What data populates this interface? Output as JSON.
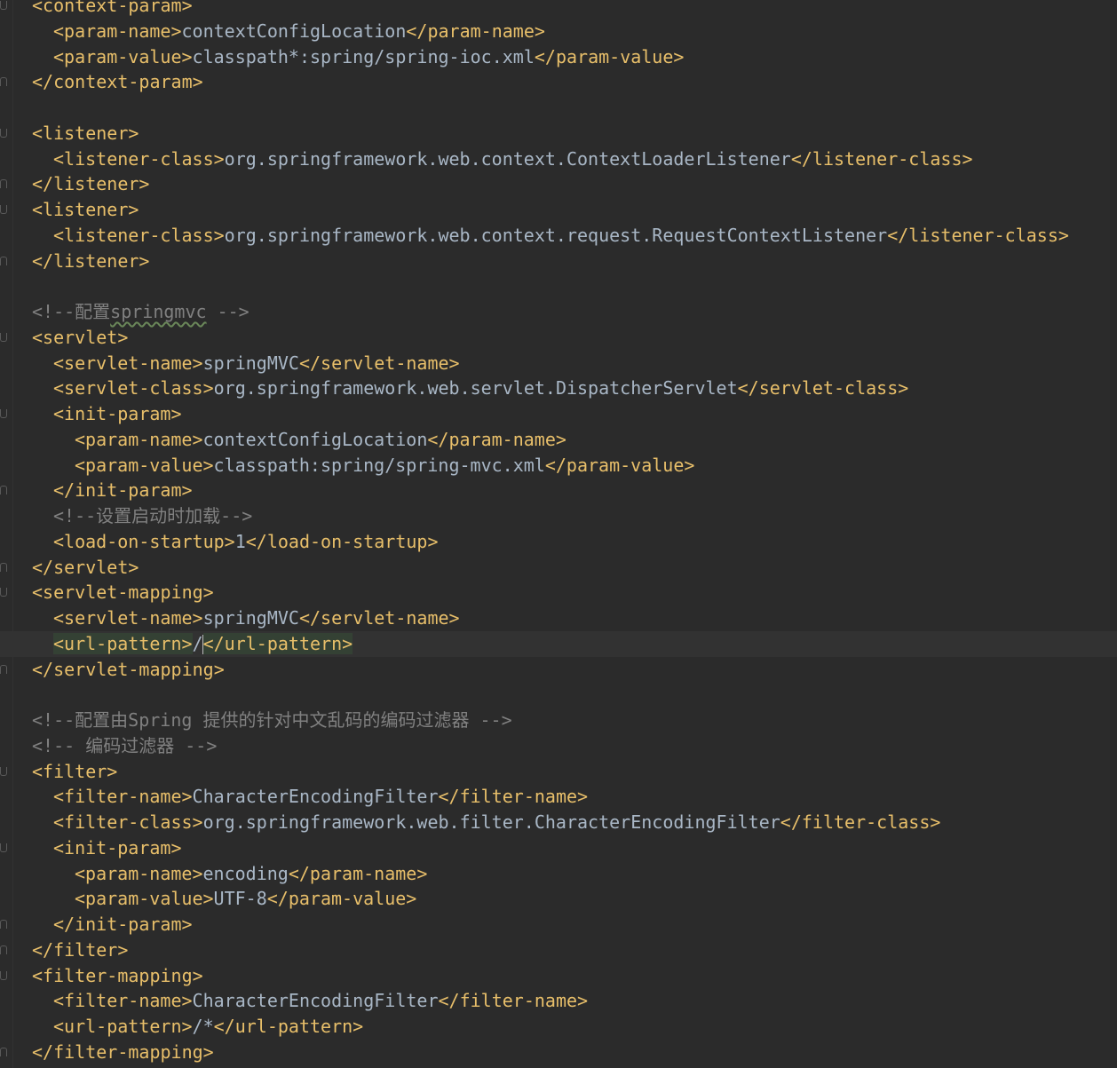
{
  "editor": {
    "lines": [
      {
        "indent": 0,
        "fold": "open",
        "parts": [
          {
            "t": "tag",
            "v": "<context-param>"
          }
        ]
      },
      {
        "indent": 1,
        "parts": [
          {
            "t": "tag",
            "v": "<param-name>"
          },
          {
            "t": "txt",
            "v": "contextConfigLocation"
          },
          {
            "t": "tag",
            "v": "</param-name>"
          }
        ]
      },
      {
        "indent": 1,
        "parts": [
          {
            "t": "tag",
            "v": "<param-value>"
          },
          {
            "t": "txt",
            "v": "classpath*:spring/spring-ioc.xml"
          },
          {
            "t": "tag",
            "v": "</param-value>"
          }
        ]
      },
      {
        "indent": 0,
        "fold": "close",
        "parts": [
          {
            "t": "tag",
            "v": "</context-param>"
          }
        ]
      },
      {
        "indent": 0,
        "parts": []
      },
      {
        "indent": 0,
        "fold": "open",
        "parts": [
          {
            "t": "tag",
            "v": "<listener>"
          }
        ]
      },
      {
        "indent": 1,
        "parts": [
          {
            "t": "tag",
            "v": "<listener-class>"
          },
          {
            "t": "txt",
            "v": "org.springframework.web.context.ContextLoaderListener"
          },
          {
            "t": "tag",
            "v": "</listener-class>"
          }
        ]
      },
      {
        "indent": 0,
        "fold": "close",
        "parts": [
          {
            "t": "tag",
            "v": "</listener>"
          }
        ]
      },
      {
        "indent": 0,
        "fold": "open",
        "parts": [
          {
            "t": "tag",
            "v": "<listener>"
          }
        ]
      },
      {
        "indent": 1,
        "parts": [
          {
            "t": "tag",
            "v": "<listener-class>"
          },
          {
            "t": "txt",
            "v": "org.springframework.web.context.request.RequestContextListener"
          },
          {
            "t": "tag",
            "v": "</listener-class>"
          }
        ]
      },
      {
        "indent": 0,
        "fold": "close",
        "parts": [
          {
            "t": "tag",
            "v": "</listener>"
          }
        ]
      },
      {
        "indent": 0,
        "parts": []
      },
      {
        "indent": 0,
        "parts": [
          {
            "t": "cmt",
            "v": "<!--配置"
          },
          {
            "t": "cmt squiggle",
            "v": "springmvc"
          },
          {
            "t": "cmt",
            "v": " -->"
          }
        ]
      },
      {
        "indent": 0,
        "fold": "open",
        "parts": [
          {
            "t": "tag",
            "v": "<servlet>"
          }
        ]
      },
      {
        "indent": 1,
        "parts": [
          {
            "t": "tag",
            "v": "<servlet-name>"
          },
          {
            "t": "txt",
            "v": "springMVC"
          },
          {
            "t": "tag",
            "v": "</servlet-name>"
          }
        ]
      },
      {
        "indent": 1,
        "parts": [
          {
            "t": "tag",
            "v": "<servlet-class>"
          },
          {
            "t": "txt",
            "v": "org.springframework.web.servlet.DispatcherServlet"
          },
          {
            "t": "tag",
            "v": "</servlet-class>"
          }
        ]
      },
      {
        "indent": 1,
        "fold": "open",
        "parts": [
          {
            "t": "tag",
            "v": "<init-param>"
          }
        ]
      },
      {
        "indent": 2,
        "parts": [
          {
            "t": "tag",
            "v": "<param-name>"
          },
          {
            "t": "txt",
            "v": "contextConfigLocation"
          },
          {
            "t": "tag",
            "v": "</param-name>"
          }
        ]
      },
      {
        "indent": 2,
        "parts": [
          {
            "t": "tag",
            "v": "<param-value>"
          },
          {
            "t": "txt",
            "v": "classpath:spring/spring-mvc.xml"
          },
          {
            "t": "tag",
            "v": "</param-value>"
          }
        ]
      },
      {
        "indent": 1,
        "fold": "close",
        "parts": [
          {
            "t": "tag",
            "v": "</init-param>"
          }
        ]
      },
      {
        "indent": 1,
        "parts": [
          {
            "t": "cmt",
            "v": "<!--设置启动时加载-->"
          }
        ]
      },
      {
        "indent": 1,
        "parts": [
          {
            "t": "tag",
            "v": "<load-on-startup>"
          },
          {
            "t": "txt",
            "v": "1"
          },
          {
            "t": "tag",
            "v": "</load-on-startup>"
          }
        ]
      },
      {
        "indent": 0,
        "fold": "close",
        "parts": [
          {
            "t": "tag",
            "v": "</servlet>"
          }
        ]
      },
      {
        "indent": 0,
        "fold": "open",
        "parts": [
          {
            "t": "tag",
            "v": "<servlet-mapping>"
          }
        ]
      },
      {
        "indent": 1,
        "parts": [
          {
            "t": "tag",
            "v": "<servlet-name>"
          },
          {
            "t": "txt",
            "v": "springMVC"
          },
          {
            "t": "tag",
            "v": "</servlet-name>"
          }
        ]
      },
      {
        "indent": 1,
        "current": true,
        "parts": [
          {
            "t": "tag hl",
            "v": "<url-pattern>"
          },
          {
            "t": "txt",
            "v": "/"
          },
          {
            "t": "caret",
            "v": ""
          },
          {
            "t": "tag hl",
            "v": "</url-pattern>"
          }
        ]
      },
      {
        "indent": 0,
        "fold": "close",
        "parts": [
          {
            "t": "tag",
            "v": "</servlet-mapping>"
          }
        ]
      },
      {
        "indent": 0,
        "parts": []
      },
      {
        "indent": 0,
        "parts": [
          {
            "t": "cmt",
            "v": "<!--配置由Spring 提供的针对中文乱码的编码过滤器 -->"
          }
        ]
      },
      {
        "indent": 0,
        "parts": [
          {
            "t": "cmt",
            "v": "<!-- 编码过滤器 -->"
          }
        ]
      },
      {
        "indent": 0,
        "fold": "open",
        "parts": [
          {
            "t": "tag",
            "v": "<filter>"
          }
        ]
      },
      {
        "indent": 1,
        "parts": [
          {
            "t": "tag",
            "v": "<filter-name>"
          },
          {
            "t": "txt",
            "v": "CharacterEncodingFilter"
          },
          {
            "t": "tag",
            "v": "</filter-name>"
          }
        ]
      },
      {
        "indent": 1,
        "parts": [
          {
            "t": "tag",
            "v": "<filter-class>"
          },
          {
            "t": "txt",
            "v": "org.springframework.web.filter.CharacterEncodingFilter"
          },
          {
            "t": "tag",
            "v": "</filter-class>"
          }
        ]
      },
      {
        "indent": 1,
        "fold": "open",
        "parts": [
          {
            "t": "tag",
            "v": "<init-param>"
          }
        ]
      },
      {
        "indent": 2,
        "parts": [
          {
            "t": "tag",
            "v": "<param-name>"
          },
          {
            "t": "txt",
            "v": "encoding"
          },
          {
            "t": "tag",
            "v": "</param-name>"
          }
        ]
      },
      {
        "indent": 2,
        "parts": [
          {
            "t": "tag",
            "v": "<param-value>"
          },
          {
            "t": "txt",
            "v": "UTF-8"
          },
          {
            "t": "tag",
            "v": "</param-value>"
          }
        ]
      },
      {
        "indent": 1,
        "fold": "close",
        "parts": [
          {
            "t": "tag",
            "v": "</init-param>"
          }
        ]
      },
      {
        "indent": 0,
        "fold": "close",
        "parts": [
          {
            "t": "tag",
            "v": "</filter>"
          }
        ]
      },
      {
        "indent": 0,
        "fold": "open",
        "parts": [
          {
            "t": "tag",
            "v": "<filter-mapping>"
          }
        ]
      },
      {
        "indent": 1,
        "parts": [
          {
            "t": "tag",
            "v": "<filter-name>"
          },
          {
            "t": "txt",
            "v": "CharacterEncodingFilter"
          },
          {
            "t": "tag",
            "v": "</filter-name>"
          }
        ]
      },
      {
        "indent": 1,
        "parts": [
          {
            "t": "tag",
            "v": "<url-pattern>"
          },
          {
            "t": "txt",
            "v": "/*"
          },
          {
            "t": "tag",
            "v": "</url-pattern>"
          }
        ]
      },
      {
        "indent": 0,
        "fold": "close",
        "parts": [
          {
            "t": "tag",
            "v": "</filter-mapping>"
          }
        ]
      }
    ]
  },
  "colors": {
    "background": "#2b2b2b",
    "tag": "#e8bf6a",
    "text": "#a9b7c6",
    "comment": "#808080",
    "tag_match_highlight": "#344134",
    "current_line": "#323232"
  }
}
